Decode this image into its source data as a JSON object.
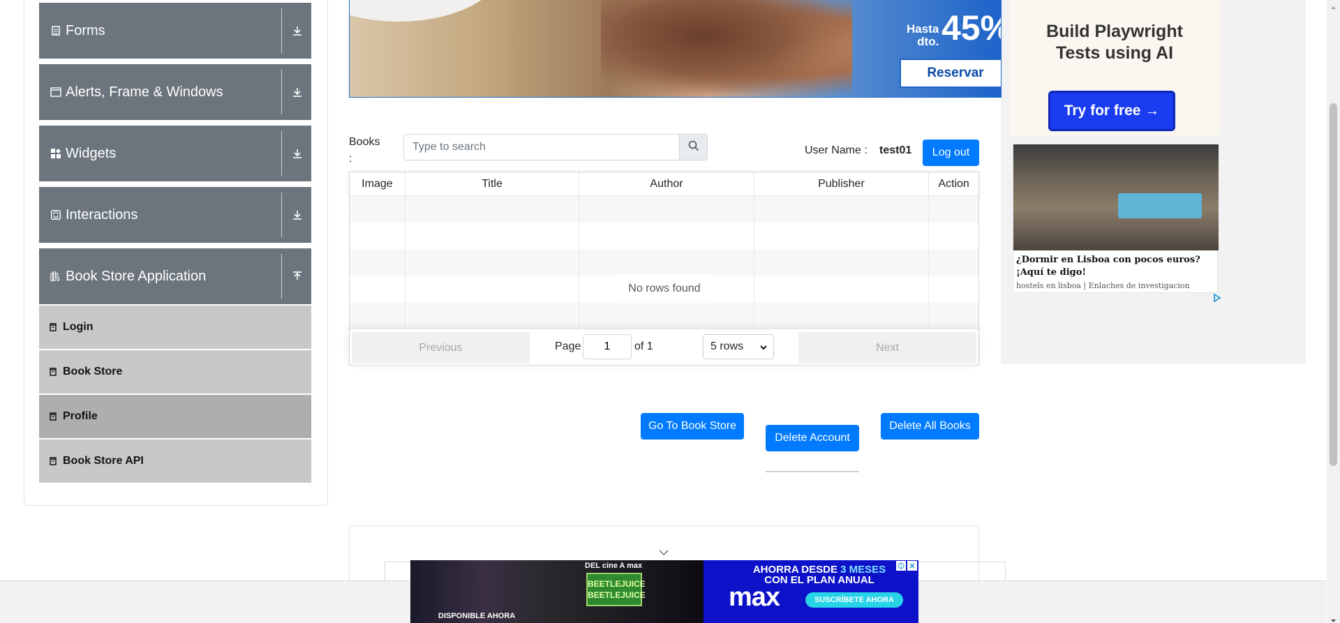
{
  "sidebar": {
    "groups": [
      {
        "label": "Forms",
        "icon": "form-icon",
        "expanded": false
      },
      {
        "label": "Alerts, Frame & Windows",
        "icon": "window-icon",
        "expanded": false
      },
      {
        "label": "Widgets",
        "icon": "widgets-icon",
        "expanded": false
      },
      {
        "label": "Interactions",
        "icon": "interactions-icon",
        "expanded": false
      },
      {
        "label": "Book Store Application",
        "icon": "books-icon",
        "expanded": true
      }
    ],
    "items": [
      {
        "label": "Login",
        "active": false
      },
      {
        "label": "Book Store",
        "active": false
      },
      {
        "label": "Profile",
        "active": true
      },
      {
        "label": "Book Store API",
        "active": false
      }
    ]
  },
  "ads": {
    "top_banner": {
      "hasta": "Hasta",
      "dto": "dto.",
      "percent": "45%",
      "cta": "Reservar"
    },
    "right": {
      "headline_line1": "Build Playwright",
      "headline_line2": "Tests using AI",
      "cta": "Try for free →",
      "card_title": "¿Dormir en Lisboa con pocos euros? ¡Aquí te digo!",
      "card_source": "hostels en lisboa | Enlaches de investigacion"
    },
    "bottom": {
      "cine": "DEL cine A max",
      "beetlejuice": "BEETLEJUICE BEETLEJUICE",
      "disponible": "DISPONIBLE AHORA",
      "tagline_prefix": "AHORRA DESDE",
      "tagline_highlight": "3 MESES",
      "tagline_line2": "CON EL PLAN ANUAL",
      "logo": "max",
      "subscribe": "SUSCRÍBETE AHORA"
    }
  },
  "profile": {
    "books_label": "Books :",
    "search_placeholder": "Type to search",
    "user_name_label": "User Name :",
    "user_name_value": "test01",
    "logout_label": "Log out"
  },
  "table": {
    "columns": [
      "Image",
      "Title",
      "Author",
      "Publisher",
      "Action"
    ],
    "empty_message": "No rows found",
    "pagination": {
      "previous": "Previous",
      "page_label": "Page",
      "page_value": "1",
      "of_label": "of 1",
      "rows_select": "5 rows",
      "next": "Next"
    }
  },
  "actions": {
    "go_to_store": "Go To Book Store",
    "delete_account": "Delete Account",
    "delete_all_books": "Delete All Books"
  },
  "colors": {
    "primary": "#007bff",
    "sidebar_group": "#6c757d",
    "menu_item": "#c8c8c8",
    "menu_item_active": "#aeaeae"
  }
}
